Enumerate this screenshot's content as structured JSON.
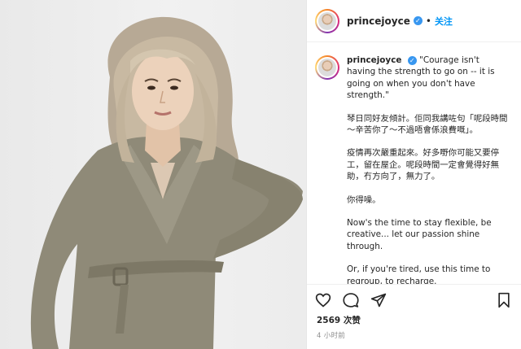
{
  "header": {
    "username": "princejoyce",
    "separator": "•",
    "follow_label": "关注"
  },
  "caption": {
    "username": "princejoyce",
    "paragraphs": [
      "\"Courage isn't having the strength to go on -- it is going on when you don't have strength.\"",
      "琴日同好友傾計。佢同我講咗句「呢段時間～辛苦你了～不過唔會係浪費嘅」。",
      "疫情再次嚴重起來。好多嘢你可能又要停工，留在屋企。呢段時間一定會覺得好無助，冇方向了，無力了。",
      "你得噪。",
      "Now's the time to stay flexible, be creative... let our passion shine through.",
      "Or, if you're tired, use this time to regroup, to recharge."
    ]
  },
  "stats": {
    "likes": "2569 次赞",
    "time": "4 小时前"
  },
  "icons": {
    "like": "heart-icon",
    "comment": "comment-icon",
    "share": "paper-plane-icon",
    "save": "bookmark-icon",
    "verified": "verified-badge-icon"
  },
  "colors": {
    "accent": "#0095f6",
    "verified": "#3897f0"
  }
}
